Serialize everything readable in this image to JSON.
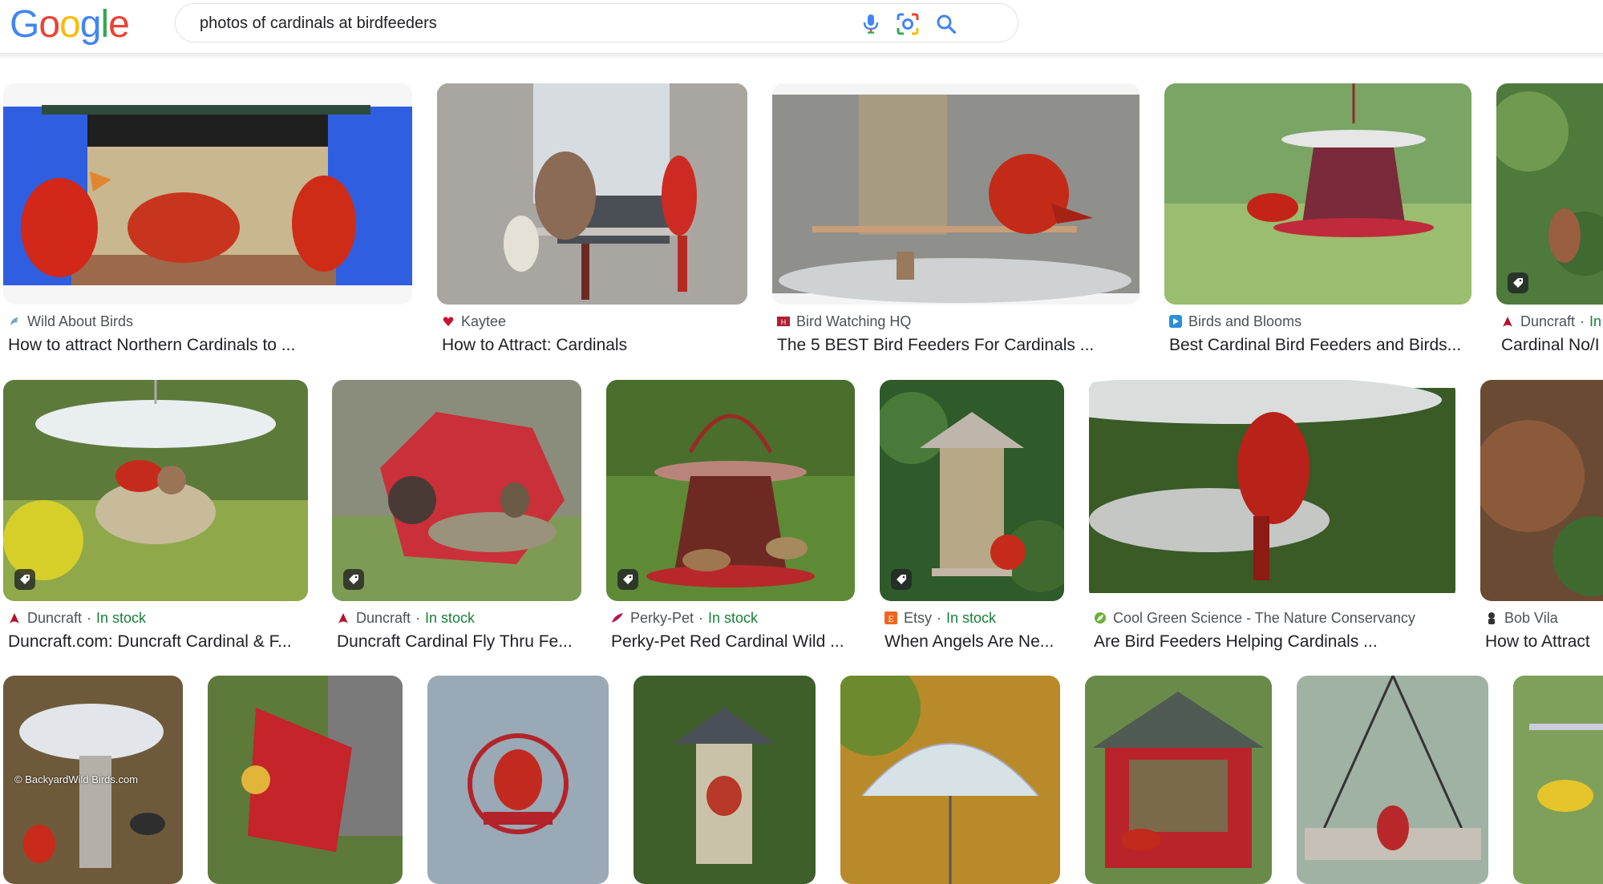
{
  "header": {
    "logo_letters": [
      "G",
      "o",
      "o",
      "g",
      "l",
      "e"
    ],
    "search": {
      "query": "photos of cardinals at birdfeeders"
    },
    "icons": [
      "mic-icon",
      "lens-icon",
      "search-icon"
    ]
  },
  "colors": {
    "google_blue": "#4285F4",
    "google_red": "#EA4335",
    "google_yellow": "#FBBC05",
    "google_green": "#34A853",
    "in_stock": "#188038",
    "title": "#202124",
    "source": "#4d5156"
  },
  "rows": [
    {
      "items": [
        {
          "source": "Wild About Birds",
          "stock": "",
          "title": "How to attract Northern Cardinals to ...",
          "favicon": "wing-icon",
          "tagged": false
        },
        {
          "source": "Kaytee",
          "stock": "",
          "title": "How to Attract: Cardinals",
          "favicon": "heart-icon",
          "tagged": false
        },
        {
          "source": "Bird Watching HQ",
          "stock": "",
          "title": "The 5 BEST Bird Feeders For Cardinals ...",
          "favicon": "hq-icon",
          "tagged": false
        },
        {
          "source": "Birds and Blooms",
          "stock": "",
          "title": "Best Cardinal Bird Feeders and Birds...",
          "favicon": "play-icon",
          "tagged": false
        },
        {
          "source": "Duncraft",
          "stock": "In",
          "title": "Cardinal No/I",
          "favicon": "cardinal-icon",
          "tagged": true
        }
      ]
    },
    {
      "items": [
        {
          "source": "Duncraft",
          "stock": "In stock",
          "title": "Duncraft.com: Duncraft Cardinal & F...",
          "favicon": "cardinal-icon",
          "tagged": true
        },
        {
          "source": "Duncraft",
          "stock": "In stock",
          "title": "Duncraft Cardinal Fly Thru Fe...",
          "favicon": "cardinal-icon",
          "tagged": true
        },
        {
          "source": "Perky-Pet",
          "stock": "In stock",
          "title": "Perky-Pet Red Cardinal Wild ...",
          "favicon": "feather-icon",
          "tagged": true
        },
        {
          "source": "Etsy",
          "stock": "In stock",
          "title": "When Angels Are Ne...",
          "favicon": "etsy-icon",
          "tagged": true
        },
        {
          "source": "Cool Green Science - The Nature Conservancy",
          "stock": "",
          "title": "Are Bird Feeders Helping Cardinals ...",
          "favicon": "leaf-icon",
          "tagged": false
        },
        {
          "source": "Bob Vila",
          "stock": "",
          "title": "How to Attract",
          "favicon": "person-icon",
          "tagged": false
        }
      ]
    },
    {
      "items": [
        {
          "watermark": "© BackyardWild Birds.com"
        },
        {},
        {},
        {},
        {},
        {},
        {},
        {}
      ]
    }
  ]
}
